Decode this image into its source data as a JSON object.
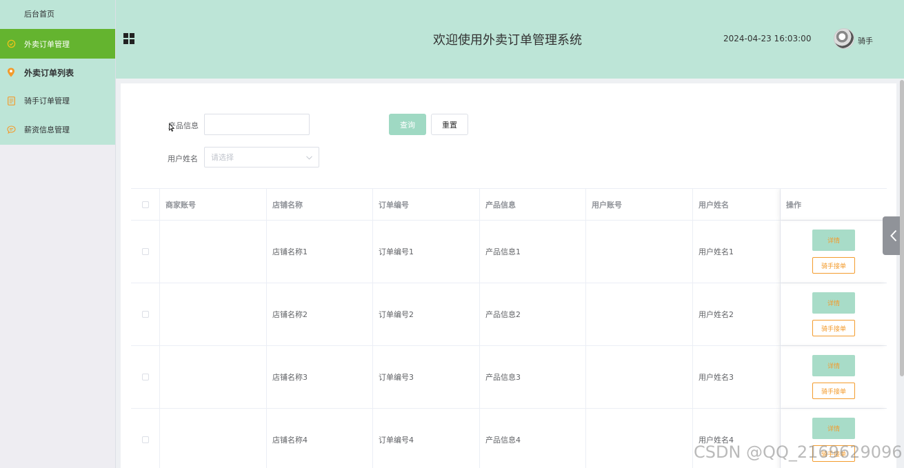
{
  "sidebar": {
    "home": "后台首页",
    "items": [
      {
        "label": "外卖订单管理",
        "icon": "circle-check-icon"
      },
      {
        "label": "外卖订单列表",
        "icon": "location-pin-icon"
      },
      {
        "label": "骑手订单管理",
        "icon": "document-icon"
      },
      {
        "label": "薪资信息管理",
        "icon": "chat-icon"
      }
    ]
  },
  "header": {
    "title": "欢迎使用外卖订单管理系统",
    "datetime": "2024-04-23 16:03:00",
    "username": "骑手"
  },
  "search": {
    "product_label": "产品信息",
    "product_value": "",
    "user_label": "用户姓名",
    "user_placeholder": "请选择",
    "query_button": "查询",
    "reset_button": "重置"
  },
  "table": {
    "columns": [
      "商家账号",
      "店铺名称",
      "订单编号",
      "产品信息",
      "用户账号",
      "用户姓名",
      "操作"
    ],
    "rows": [
      {
        "merchant_account": "",
        "shop_name": "店铺名称1",
        "order_no": "订单编号1",
        "product": "产品信息1",
        "user_account": "",
        "user_name": "用户姓名1"
      },
      {
        "merchant_account": "",
        "shop_name": "店铺名称2",
        "order_no": "订单编号2",
        "product": "产品信息2",
        "user_account": "",
        "user_name": "用户姓名2"
      },
      {
        "merchant_account": "",
        "shop_name": "店铺名称3",
        "order_no": "订单编号3",
        "product": "产品信息3",
        "user_account": "",
        "user_name": "用户姓名3"
      },
      {
        "merchant_account": "",
        "shop_name": "店铺名称4",
        "order_no": "订单编号4",
        "product": "产品信息4",
        "user_account": "",
        "user_name": "用户姓名4"
      }
    ],
    "detail_button": "详情",
    "accept_button": "骑手接单"
  },
  "watermark": "CSDN @QQ_2169629096",
  "colors": {
    "theme": "#bde5d7",
    "active_menu": "#64b42f",
    "accent_orange": "#f39b2c",
    "query_button": "#9fd9c3"
  }
}
